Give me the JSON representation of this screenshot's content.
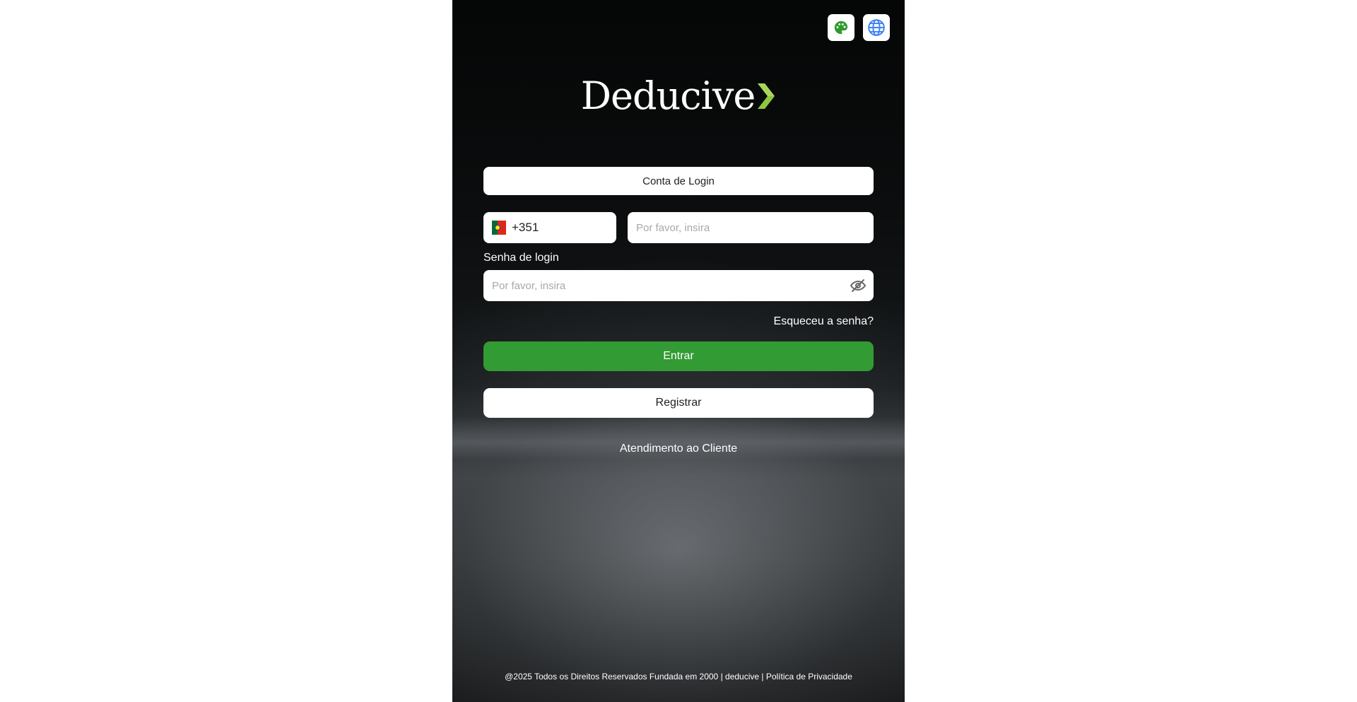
{
  "header": {
    "theme_icon": "palette-icon",
    "language_icon": "globe-icon",
    "theme_icon_color": "#2e9a2e",
    "language_icon_color": "#3b82f6"
  },
  "logo": {
    "text": "Deducive",
    "accent_glyph": ">",
    "accent_color": "#8dc63f"
  },
  "login_type": {
    "label": "Conta de Login"
  },
  "phone": {
    "country_flag": "flag-portugal-icon",
    "country_code": "+351",
    "placeholder": "Por favor, insira"
  },
  "password": {
    "label": "Senha de login",
    "placeholder": "Por favor, insira",
    "toggle_icon": "eye-slash-icon"
  },
  "links": {
    "forgot": "Esqueceu a senha?",
    "support": "Atendimento ao Cliente"
  },
  "buttons": {
    "login": "Entrar",
    "register": "Registrar",
    "login_color": "#339b33"
  },
  "footer": {
    "text": "@2025 Todos os Direitos Reservados Fundada em 2000 | deducive | Política de Privacidade"
  }
}
